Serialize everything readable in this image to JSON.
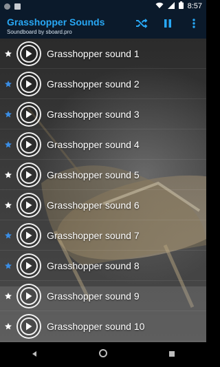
{
  "status_bar": {
    "time": "8:57"
  },
  "app_bar": {
    "title": "Grasshopper Sounds",
    "subtitle": "Soundboard by sboard.pro",
    "icons": [
      "shuffle-icon",
      "pause-icon",
      "more-vert-icon"
    ]
  },
  "colors": {
    "accent": "#28a8f5",
    "app_bar_bg": "#0b1a2b",
    "star_active": "#3a8ee6",
    "star_inactive": "#ffffff"
  },
  "sounds": [
    {
      "label": "Grasshopper sound 1",
      "favorite": false
    },
    {
      "label": "Grasshopper sound 2",
      "favorite": true
    },
    {
      "label": "Grasshopper sound 3",
      "favorite": true
    },
    {
      "label": "Grasshopper sound 4",
      "favorite": true
    },
    {
      "label": "Grasshopper sound 5",
      "favorite": false
    },
    {
      "label": "Grasshopper sound 6",
      "favorite": false
    },
    {
      "label": "Grasshopper sound 7",
      "favorite": true
    },
    {
      "label": "Grasshopper sound 8",
      "favorite": true
    },
    {
      "label": "Grasshopper sound 9",
      "favorite": false
    },
    {
      "label": "Grasshopper sound 10",
      "favorite": false
    }
  ]
}
